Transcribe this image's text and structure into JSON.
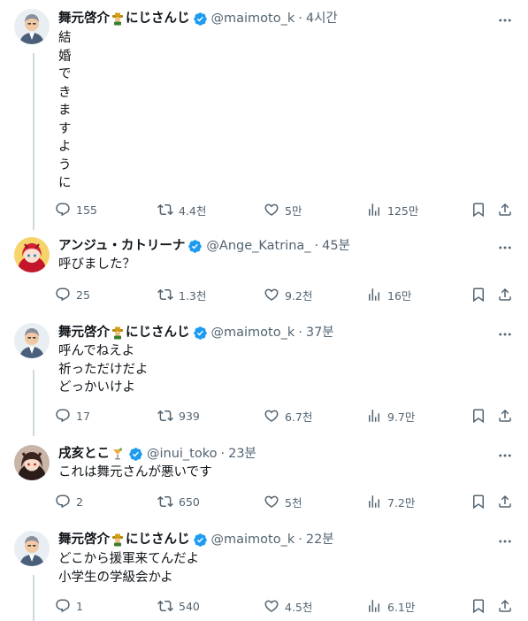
{
  "tweets": [
    {
      "name": "舞元啓介",
      "name_suffix": "にじさんじ",
      "handle": "@maimoto_k",
      "time": "4시간",
      "lines": [
        "結",
        "婚",
        "で",
        "き",
        "ま",
        "す",
        "よ",
        "う",
        "に"
      ],
      "replies": "155",
      "retweets": "4.4천",
      "likes": "5만",
      "views": "125만"
    },
    {
      "name": "アンジュ・カトリーナ",
      "handle": "@Ange_Katrina_",
      "time": "45분",
      "lines": [
        "呼びました？"
      ],
      "replies": "25",
      "retweets": "1.3천",
      "likes": "9.2천",
      "views": "16만"
    },
    {
      "name": "舞元啓介",
      "name_suffix": "にじさんじ",
      "handle": "@maimoto_k",
      "time": "37분",
      "lines": [
        "呼んでねえよ",
        "祈っただけだよ",
        "どっかいけよ"
      ],
      "replies": "17",
      "retweets": "939",
      "likes": "6.7천",
      "views": "9.7만"
    },
    {
      "name": "戌亥とこ",
      "handle": "@inui_toko",
      "time": "23분",
      "lines": [
        "これは舞元さんが悪いです"
      ],
      "replies": "2",
      "retweets": "650",
      "likes": "5천",
      "views": "7.2만"
    },
    {
      "name": "舞元啓介",
      "name_suffix": "にじさんじ",
      "handle": "@maimoto_k",
      "time": "22분",
      "lines": [
        "どこから援軍来てんだよ",
        "小学生の学級会かよ"
      ],
      "replies": "1",
      "retweets": "540",
      "likes": "4.5천",
      "views": "6.1만"
    }
  ],
  "dot": "·",
  "icons": {
    "reply": "reply-icon",
    "retweet": "retweet-icon",
    "like": "heart-icon",
    "views": "views-icon",
    "bookmark": "bookmark-icon",
    "share": "share-icon",
    "more": "more-icon",
    "verified": "verified-badge-icon"
  },
  "colors": {
    "text": "#0f1419",
    "secondary": "#536471",
    "verified": "#1d9bf0",
    "thread": "#cfd9de"
  }
}
